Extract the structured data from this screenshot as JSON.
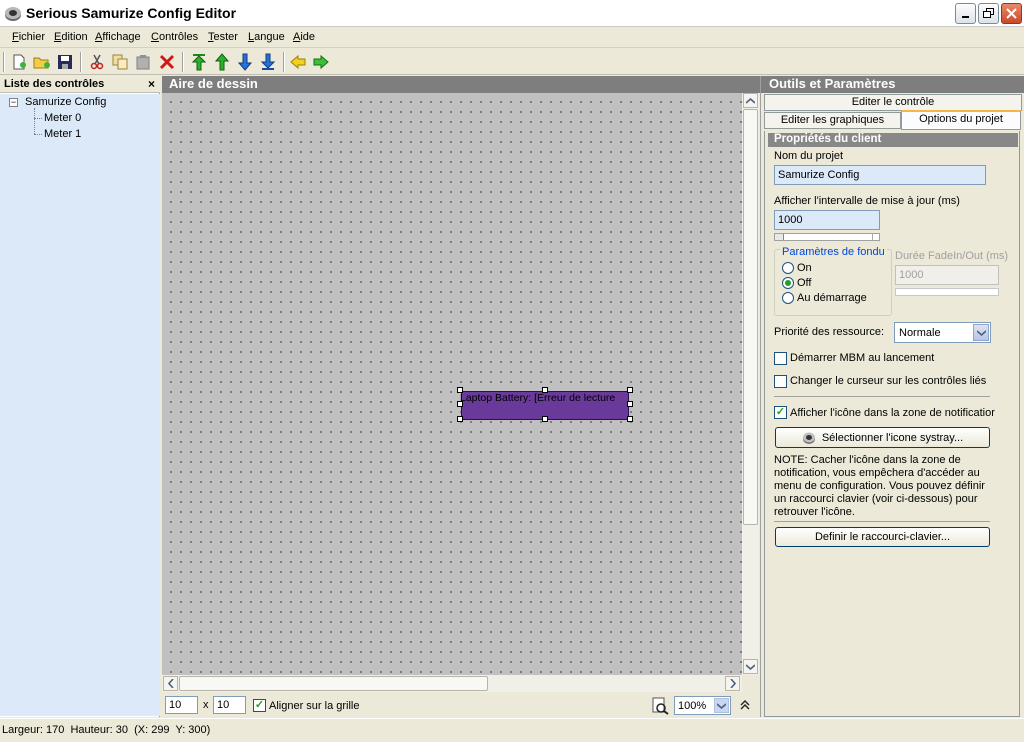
{
  "window": {
    "title": "Serious Samurize Config Editor",
    "app_icon": "samurize-app-icon",
    "controls": [
      "minimize-icon",
      "restore-icon",
      "close-icon"
    ]
  },
  "menu": [
    {
      "label": "Fichier",
      "underline": "F",
      "rest": "ichier"
    },
    {
      "label": "Edition",
      "underline": "E",
      "rest": "dition"
    },
    {
      "label": "Affichage",
      "underline": "A",
      "rest": "ffichage"
    },
    {
      "label": "Contrôles",
      "underline": "C",
      "rest": "ontrôles"
    },
    {
      "label": "Tester",
      "underline": "T",
      "rest": "ester"
    },
    {
      "label": "Langue",
      "underline": "L",
      "rest": "angue"
    },
    {
      "label": "Aide",
      "underline": "A",
      "rest": "ide"
    }
  ],
  "toolbar": {
    "buttons": [
      "new-icon",
      "open-icon",
      "save-icon",
      "cut-icon",
      "copy-icon",
      "paste-icon",
      "delete-icon",
      "move-top-icon",
      "move-up-icon",
      "move-down-icon",
      "move-bottom-icon",
      "back-icon",
      "forward-icon"
    ]
  },
  "left_panel": {
    "title": "Liste des contrôles",
    "close_glyph": "×",
    "tree": {
      "root": "Samurize Config",
      "expander": "−",
      "children": [
        "Meter 0",
        "Meter 1"
      ]
    }
  },
  "drawing": {
    "title": "Aire de dessin",
    "meter_text": "Laptop Battery: [Erreur de lecture",
    "meter_color": "#6a3a9a",
    "grid_x": "10",
    "times": "x",
    "grid_y": "10",
    "align_label": "Aligner sur la grille",
    "align_checked": true,
    "zoom": "100%"
  },
  "right_panel": {
    "title": "Outils et Paramètres",
    "tabs": {
      "edit_control": "Editer le contrôle",
      "edit_graphics": "Editer les graphiques",
      "project_options": "Options du projet"
    },
    "section_title": "Propriétés du client",
    "project_name_label": "Nom du projet",
    "project_name": "Samurize Config",
    "interval_label": "Afficher l'intervalle de mise à jour (ms)",
    "interval": "1000",
    "interval_slider_level": 0.1,
    "fade_group_label": "Paramètres de fondu",
    "fade_options": [
      "On",
      "Off",
      "Au démarrage"
    ],
    "fade_selected": "Off",
    "fade_duration_label": "Durée FadeIn/Out (ms)",
    "fade_duration": "1000",
    "priority_label": "Priorité des ressource:",
    "priority_value": "Normale",
    "start_mbm_label": "Démarrer MBM au lancement",
    "start_mbm_checked": false,
    "cursor_label": "Changer le curseur sur les contrôles liés",
    "cursor_checked": false,
    "tray_label": "Afficher l'icône dans la zone de notificatior",
    "tray_checked": true,
    "select_tray_button": "Sélectionner l'icone systray...",
    "note": [
      "NOTE: Cacher l'icône dans la zone de",
      "notification, vous empêchera d'accéder au",
      "menu de configuration. Vous pouvez définir",
      "un raccourci clavier (voir ci-dessous) pour",
      "retrouver l'icône."
    ],
    "shortcut_button": "Definir le raccourci-clavier..."
  },
  "status_bar": {
    "text": "Largeur: 170  Hauteur: 30  (X: 299  Y: 300)"
  }
}
